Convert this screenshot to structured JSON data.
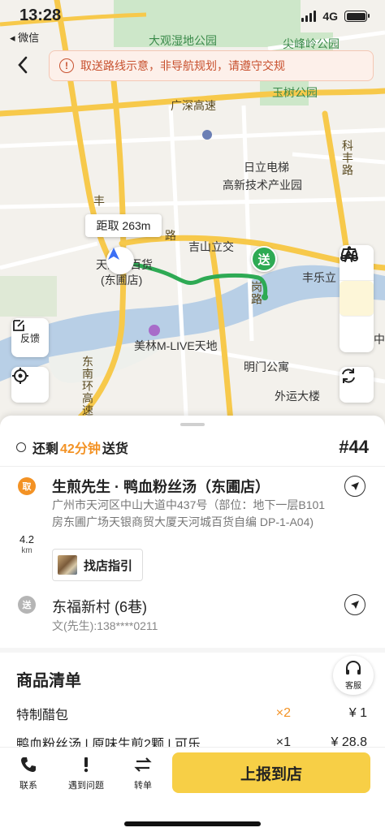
{
  "status_bar": {
    "time": "13:28",
    "back_app": "◂ 微信",
    "network": "4G"
  },
  "map": {
    "notice": "取送路线示意，非导航规划，请遵守交规",
    "distance_tip": "距取 263m",
    "deliver_pin": "送",
    "labels": {
      "park_top": "大观湿地公园",
      "ridge_park": "尖峰岭公园",
      "yushu_park": "玉树公园",
      "guangshen": "广深高速",
      "rili": "日立电梯",
      "hitech": "高新技术产业园",
      "jishan": "吉山立交",
      "fengle": "丰乐立",
      "meilin": "美林M-LIVE天地",
      "mingmen": "明门公寓",
      "waiyun": "外运大楼",
      "huan": "东南环高速",
      "kefeng": "科丰路",
      "shop_label": "天河城百货",
      "shop_label2": "(东圃店)",
      "road_v": "岗路",
      "road_v2": "丰",
      "road_v3": "路",
      "zhongmen": "中门"
    },
    "buttons": {
      "feedback": "反馈"
    },
    "colors": {
      "route": "#2eaa54",
      "highway": "#f7c94b",
      "river": "#b8cfe6",
      "park": "#cde7c9"
    }
  },
  "order": {
    "eta_prefix": "还剩",
    "eta_value": "42分钟",
    "eta_suffix": "送货",
    "order_no": "#44",
    "pickup": {
      "tag": "取",
      "name": "生煎先生 · 鸭血粉丝汤（东圃店）",
      "address": "广州市天河区中山大道中437号（部位：地下一层B101房东圃广场天银商贸大厦天河城百货自编 DP-1-A04)",
      "distance_num": "4.2",
      "distance_unit": "km",
      "guide_label": "找店指引"
    },
    "dropoff": {
      "tag": "送",
      "name": "东福新村 (6巷)",
      "contact": "文(先生):138****0211"
    }
  },
  "goods": {
    "title": "商品清单",
    "service_label": "客服",
    "items": [
      {
        "name": "特制醋包",
        "qty": "×2",
        "price": "¥ 1"
      },
      {
        "name": "鸭血粉丝汤 | 原味生煎2颗 | 可乐",
        "qty": "×1",
        "price": "¥ 28.8"
      }
    ]
  },
  "bottom_bar": {
    "contact": "联系",
    "problem": "遇到问题",
    "transfer": "转单",
    "report": "上报到店"
  }
}
